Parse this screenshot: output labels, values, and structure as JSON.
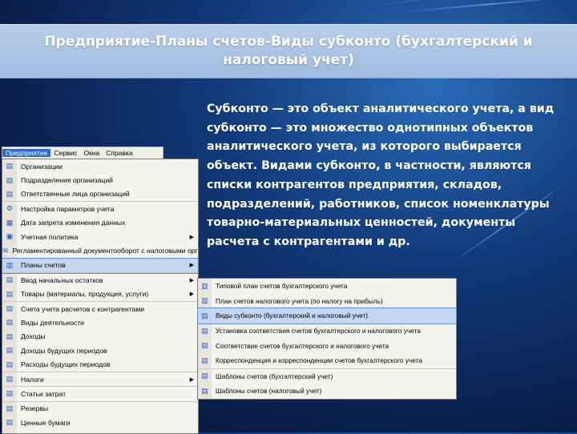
{
  "slide": {
    "title": "Предприятие-Планы счетов-Виды субконто (бухгалтерский и налоговый учет)",
    "description": "Субконто — это объект аналитического учета, а вид субконто — это множество однотипных объектов аналитического учета, из которого выбирается объект. Видами субконто, в частности, являются списки контрагентов предприятия, складов, подразделений, работников, список номенклатуры товарно-материальных ценностей, документы расчета с контрагентами и др."
  },
  "menubar": {
    "items": [
      "Предприятие",
      "Сервис",
      "Окна",
      "Справка"
    ]
  },
  "menu": {
    "items": [
      {
        "label": "Организации",
        "icon": "catalog-icon"
      },
      {
        "label": "Подразделения организаций",
        "icon": "catalog-icon"
      },
      {
        "label": "Ответственные лица организаций",
        "icon": "catalog-icon"
      },
      {
        "label": "Настройка параметров учета",
        "icon": "settings-icon"
      },
      {
        "label": "Дата запрета изменения данных",
        "icon": "calendar-icon"
      },
      {
        "label": "Учетная политика",
        "icon": "policy-icon",
        "arrow": "▶"
      },
      {
        "label": "Регламентированный документооборот с налоговыми органами",
        "icon": "document-icon"
      },
      {
        "label": "Планы счетов",
        "icon": "accounts-icon",
        "arrow": "▶",
        "highlighted": true
      },
      {
        "label": "Ввод начальных остатков",
        "icon": "balance-icon",
        "arrow": "▶"
      },
      {
        "label": "Товары (материалы, продукция, услуги)",
        "icon": "goods-icon",
        "arrow": "▶"
      },
      {
        "label": "Счета учета расчетов с контрагентами",
        "icon": "catalog-icon"
      },
      {
        "label": "Виды деятельности",
        "icon": "catalog-icon"
      },
      {
        "label": "Доходы",
        "icon": "catalog-icon"
      },
      {
        "label": "Доходы будущих периодов",
        "icon": "catalog-icon"
      },
      {
        "label": "Расходы будущих периодов",
        "icon": "catalog-icon"
      },
      {
        "label": "Налоги",
        "icon": "tax-icon",
        "arrow": "▶"
      },
      {
        "label": "Статьи затрат",
        "icon": "catalog-icon"
      },
      {
        "label": "Резервы",
        "icon": "catalog-icon"
      },
      {
        "label": "Ценные бумаги",
        "icon": "catalog-icon"
      }
    ]
  },
  "submenu": {
    "items": [
      {
        "label": "Типовой план счетов бухгалтерского учета",
        "icon": "chart-of-accounts-icon"
      },
      {
        "label": "План счетов налогового учета (по налогу на прибыль)",
        "icon": "chart-of-accounts-icon"
      },
      {
        "label": "Виды субконто (бухгалтерский и налоговый учет)",
        "icon": "subconto-icon",
        "highlighted": true
      },
      {
        "label": "Установка соответствия счетов бухгалтерского и налогового учета",
        "icon": "mapping-icon"
      },
      {
        "label": "Соответствие счетов бухгалтерского и налогового учета",
        "icon": "mapping-icon"
      },
      {
        "label": "Корреспонденция и корреспонденции счетов бухгалтерского учета",
        "icon": "mapping-icon"
      },
      {
        "label": "Шаблоны счетов (бухгалтерский учет)",
        "icon": "template-icon"
      },
      {
        "label": "Шаблоны счетов (налоговый учет)",
        "icon": "template-icon"
      }
    ]
  },
  "colors": {
    "background": "#0a1f4d",
    "title_bar": "#9fbbe0",
    "text": "#ffffff",
    "highlight": "#c5d7f0"
  }
}
